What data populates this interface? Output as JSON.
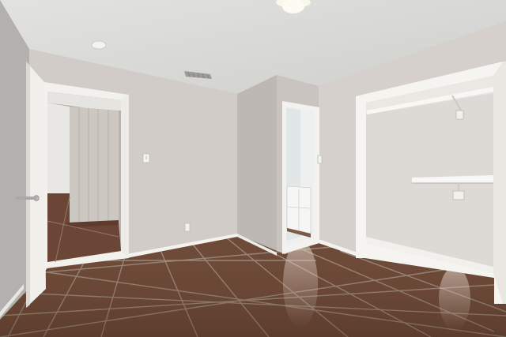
{
  "scene": {
    "kind": "empty bedroom interior photo",
    "colors": {
      "ceiling": "#dcdcda",
      "wall_left": "#b3b0ad",
      "wall_main": "#d1ccc8",
      "wall_corner": "#bdb8b4",
      "wall_right": "#d5d0cb",
      "trim": "#f4f2ef",
      "floor_tile": "#6e4a38",
      "grout": "#9a8778",
      "closet_interior": "#ddd9d4"
    },
    "icons": [
      "ceiling-light-icon",
      "smoke-detector-icon",
      "air-vent-icon",
      "light-switch-icon",
      "outlet-icon",
      "door-lever-icon"
    ]
  }
}
